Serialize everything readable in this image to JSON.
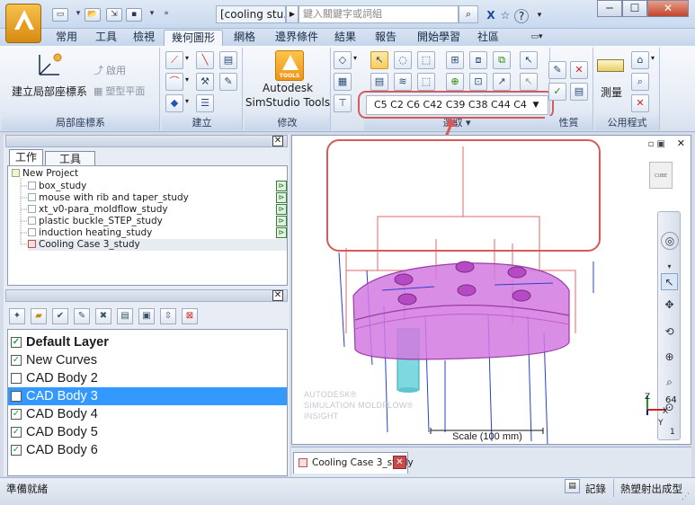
{
  "title_bar": {
    "document_title": "[cooling stu...",
    "search_placeholder": "鍵入關鍵字或詞組",
    "min_label": "─",
    "max_label": "☐",
    "close_label": "✕"
  },
  "ribbon_tabs": [
    "常用",
    "工具",
    "檢視",
    "幾何圖形",
    "網格",
    "邊界條件",
    "結果",
    "報告",
    "開始學習",
    "社區"
  ],
  "active_tab": "幾何圖形",
  "ribbon": {
    "local_cs": {
      "label": "建立局部座標系",
      "activate": "啟用",
      "model_plane": "塑型平面",
      "group": "局部座標系"
    },
    "create": {
      "group": "建立"
    },
    "modify": {
      "tools_badge": "TOOLS",
      "label_line1": "Autodesk",
      "label_line2": "SimStudio Tools",
      "group": "修改"
    },
    "select": {
      "filter_value": "C5 C2 C6 C42 C39 C38 C44 C4",
      "group": "選取"
    },
    "properties": {
      "group": "性質"
    },
    "utilities": {
      "measure": "測量",
      "group": "公用程式"
    }
  },
  "left_panel": {
    "tabs": [
      "工作",
      "工具"
    ],
    "project_name": "New Project",
    "studies": [
      {
        "name": "box_study",
        "selected": false
      },
      {
        "name": "mouse with rib and taper_study",
        "selected": false
      },
      {
        "name": "xt_v0-para_moldflow_study",
        "selected": false
      },
      {
        "name": "plastic buckle_STEP_study",
        "selected": false
      },
      {
        "name": "induction heating_study",
        "selected": false
      },
      {
        "name": "Cooling Case 3_study",
        "selected": true
      }
    ],
    "layers": [
      {
        "name": "Default Layer",
        "checked": true,
        "bold": true,
        "selected": false
      },
      {
        "name": "New Curves",
        "checked": true,
        "bold": false,
        "selected": false
      },
      {
        "name": "CAD Body 2",
        "checked": false,
        "bold": false,
        "selected": false
      },
      {
        "name": "CAD Body 3",
        "checked": false,
        "bold": false,
        "selected": true
      },
      {
        "name": "CAD Body 4",
        "checked": true,
        "bold": false,
        "selected": false
      },
      {
        "name": "CAD Body 5",
        "checked": true,
        "bold": false,
        "selected": false
      },
      {
        "name": "CAD Body 6",
        "checked": true,
        "bold": false,
        "selected": false
      }
    ]
  },
  "viewport": {
    "watermark_line1": "AUTODESK®",
    "watermark_line2": "SIMULATION MOLDFLOW®",
    "watermark_line3": "INSIGHT",
    "scale_label": "Scale (100 mm)",
    "axis_z": "Z",
    "axis_x": "X",
    "axis_y": "Y",
    "axis_num": "64",
    "axis_one": "1",
    "document_tab": "Cooling Case 3_study"
  },
  "status": {
    "left_text": "準備就緒",
    "record_label": "記錄",
    "analysis_label": "熱塑射出成型"
  },
  "colors": {
    "highlight_red": "#d65a5a",
    "part_magenta": "#d279e0",
    "selection_blue": "#3399ff",
    "cooling_line_blue": "#2a3fd0"
  }
}
